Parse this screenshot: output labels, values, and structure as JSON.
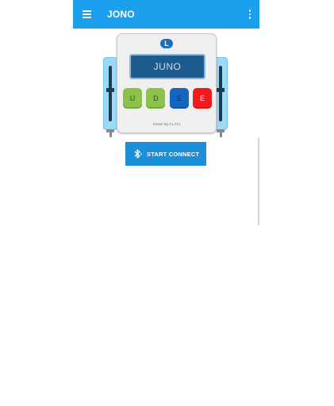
{
  "appbar": {
    "title": "JONO"
  },
  "device": {
    "display_text": "JUNO",
    "logo_text": "L",
    "buttons": [
      {
        "label": "U",
        "color": "#8bc34a"
      },
      {
        "label": "D",
        "color": "#8bc34a"
      },
      {
        "label": "S",
        "color": "#1565c0"
      },
      {
        "label": "E",
        "color": "#f21b1b"
      }
    ],
    "powered_by": "Power By CL Pro"
  },
  "connect_button": {
    "label": "START CONNECT",
    "icon": "bluetooth-icon"
  },
  "colors": {
    "appbar": "#1aa0ec",
    "connect": "#1b8fd8"
  }
}
